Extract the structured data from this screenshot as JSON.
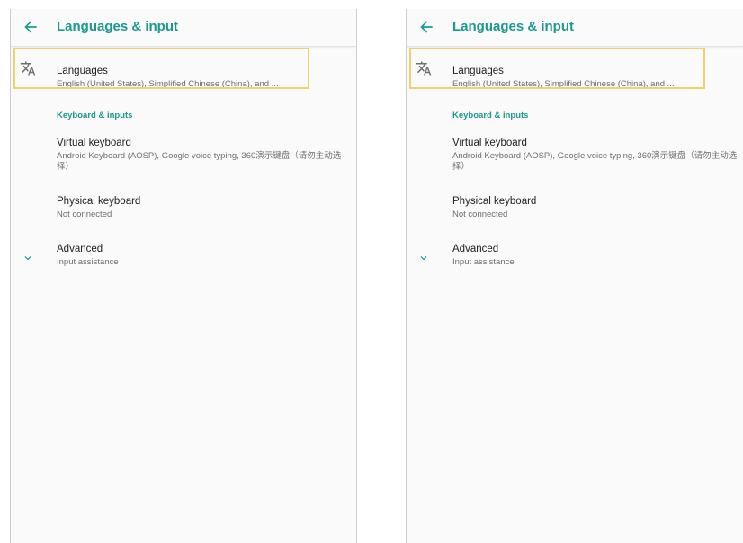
{
  "app": {
    "title": "Languages & input"
  },
  "languages": {
    "label": "Languages",
    "summary": "English (United States), Simplified Chinese (China), and ..."
  },
  "section": {
    "header": "Keyboard & inputs"
  },
  "virtual_keyboard": {
    "label": "Virtual keyboard",
    "summary": "Android Keyboard (AOSP), Google voice typing, 360演示键盘（请勿主动选择）"
  },
  "physical_keyboard": {
    "label": "Physical keyboard",
    "summary": "Not connected"
  },
  "advanced": {
    "label": "Advanced",
    "summary": "Input assistance"
  },
  "icons": {
    "back": "arrow-back-icon",
    "language": "translate-icon",
    "expand": "chevron-down-icon"
  },
  "colors": {
    "accent": "#1a9a8e",
    "highlight": "#ecd36b",
    "background": "#fafafa",
    "primary_text": "#212121",
    "secondary_text": "#6d6d6d"
  }
}
